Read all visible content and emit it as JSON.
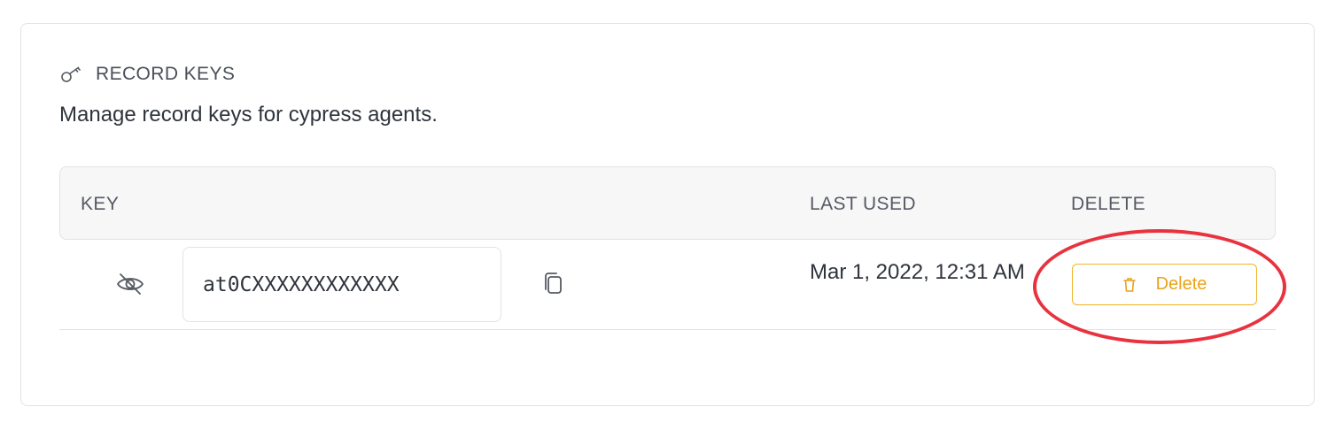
{
  "section": {
    "title": "RECORD KEYS",
    "icon": "key-icon",
    "description": "Manage record keys for cypress agents."
  },
  "table": {
    "columns": {
      "key": "KEY",
      "last_used": "LAST USED",
      "delete": "DELETE"
    },
    "rows": [
      {
        "key_value": "at0CXXXXXXXXXXXX",
        "visibility_icon": "eye-off-icon",
        "copy_icon": "copy-icon",
        "last_used": "Mar 1, 2022, 12:31 AM",
        "delete_label": "Delete",
        "delete_icon": "trash-icon"
      }
    ]
  },
  "colors": {
    "delete_accent": "#f0b429",
    "highlight_ring": "#e8333f"
  }
}
